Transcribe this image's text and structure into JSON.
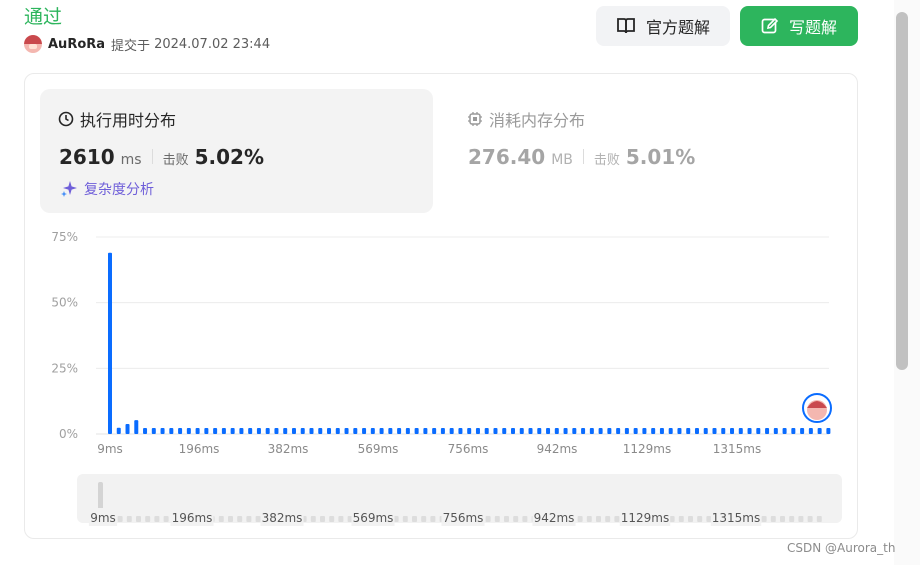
{
  "submission": {
    "status": "通过",
    "username": "AuRoRa",
    "submitted_label": "提交于",
    "datetime": "2024.07.02 23:44"
  },
  "buttons": {
    "official_solution": "官方题解",
    "write_solution": "写题解"
  },
  "runtime": {
    "title": "执行用时分布",
    "value": "2610",
    "unit": "ms",
    "beat_label": "击败",
    "beat_percent": "5.02%",
    "analysis_label": "复杂度分析"
  },
  "memory": {
    "title": "消耗内存分布",
    "value": "276.40",
    "unit": "MB",
    "beat_label": "击败",
    "beat_percent": "5.01%"
  },
  "chart_data": {
    "type": "bar",
    "y_ticks": [
      "75%",
      "50%",
      "25%",
      "0%"
    ],
    "ylim": [
      0,
      75
    ],
    "x_ticks": [
      "9ms",
      "196ms",
      "382ms",
      "569ms",
      "756ms",
      "942ms",
      "1129ms",
      "1315ms"
    ],
    "values": [
      69,
      2.4,
      3.8,
      5.3,
      2.3,
      2.3,
      2.3,
      2.3,
      2.3,
      2.3,
      2.3,
      2.3,
      2.3,
      2.3,
      2.3,
      2.3,
      2.3,
      2.3,
      2.3,
      2.3,
      2.3,
      2.3,
      2.3,
      2.3,
      2.3,
      2.3,
      2.3,
      2.3,
      2.3,
      2.3,
      2.3,
      2.3,
      2.3,
      2.3,
      2.3,
      2.3,
      2.3,
      2.3,
      2.3,
      2.3,
      2.3,
      2.3,
      2.3,
      2.3,
      2.3,
      2.3,
      2.3,
      2.3,
      2.3,
      2.3,
      2.3,
      2.3,
      2.3,
      2.3,
      2.3,
      2.3,
      2.3,
      2.3,
      2.3,
      2.3,
      2.3,
      2.3,
      2.3,
      2.3,
      2.3,
      2.3,
      2.3,
      2.3,
      2.3,
      2.3,
      2.3,
      2.3,
      2.3,
      2.3,
      2.3,
      2.3,
      2.3,
      2.3,
      2.3,
      2.3,
      2.3,
      2.3,
      2.3
    ],
    "bar_color": "#0a6cff",
    "grid": true,
    "navigator_ticks": [
      "9ms",
      "196ms",
      "382ms",
      "569ms",
      "756ms",
      "942ms",
      "1129ms",
      "1315ms"
    ]
  },
  "watermark": "CSDN @Aurora_th",
  "colors": {
    "accent_green": "#2db55d",
    "bar_blue": "#0a6cff",
    "analysis_purple": "#6f5fd9"
  }
}
